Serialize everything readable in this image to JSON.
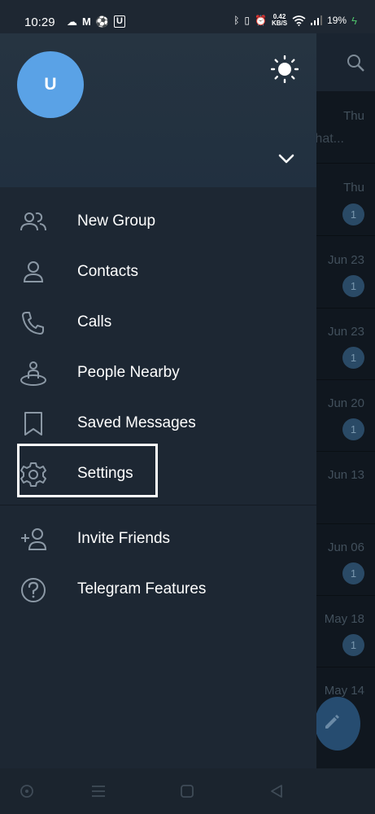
{
  "status_bar": {
    "time": "10:29",
    "net_speed_value": "0.42",
    "net_speed_unit": "KB/S",
    "battery": "19%",
    "icons": [
      "cloud-icon",
      "gmail-icon",
      "football-icon",
      "u-app-icon",
      "bluetooth-icon",
      "vibrate-icon",
      "alarm-icon",
      "wifi-icon",
      "signal-icon",
      "battery-charging-icon"
    ]
  },
  "drawer": {
    "avatar_initial": "U",
    "menu_items": [
      {
        "label": "New Group",
        "icon": "new-group-icon"
      },
      {
        "label": "Contacts",
        "icon": "contact-icon"
      },
      {
        "label": "Calls",
        "icon": "phone-icon"
      },
      {
        "label": "People Nearby",
        "icon": "people-nearby-icon"
      },
      {
        "label": "Saved Messages",
        "icon": "bookmark-icon"
      },
      {
        "label": "Settings",
        "icon": "gear-icon"
      }
    ],
    "secondary_items": [
      {
        "label": "Invite Friends",
        "icon": "add-person-icon"
      },
      {
        "label": "Telegram Features",
        "icon": "question-icon"
      }
    ]
  },
  "background_chats": [
    {
      "date": "Thu",
      "snippet": "hat..."
    },
    {
      "date": "Thu",
      "badge": "1"
    },
    {
      "date": "Jun 23",
      "badge": "1"
    },
    {
      "date": "Jun 23",
      "badge": "1"
    },
    {
      "date": "Jun 20",
      "badge": "1"
    },
    {
      "date": "Jun 13"
    },
    {
      "date": "Jun 06",
      "badge": "1"
    },
    {
      "date": "May 18",
      "badge": "1"
    },
    {
      "date": "May 14"
    }
  ],
  "colors": {
    "drawer_bg": "#1d2733",
    "avatar_bg": "#5aa2e6",
    "highlight": "#ffffff"
  }
}
